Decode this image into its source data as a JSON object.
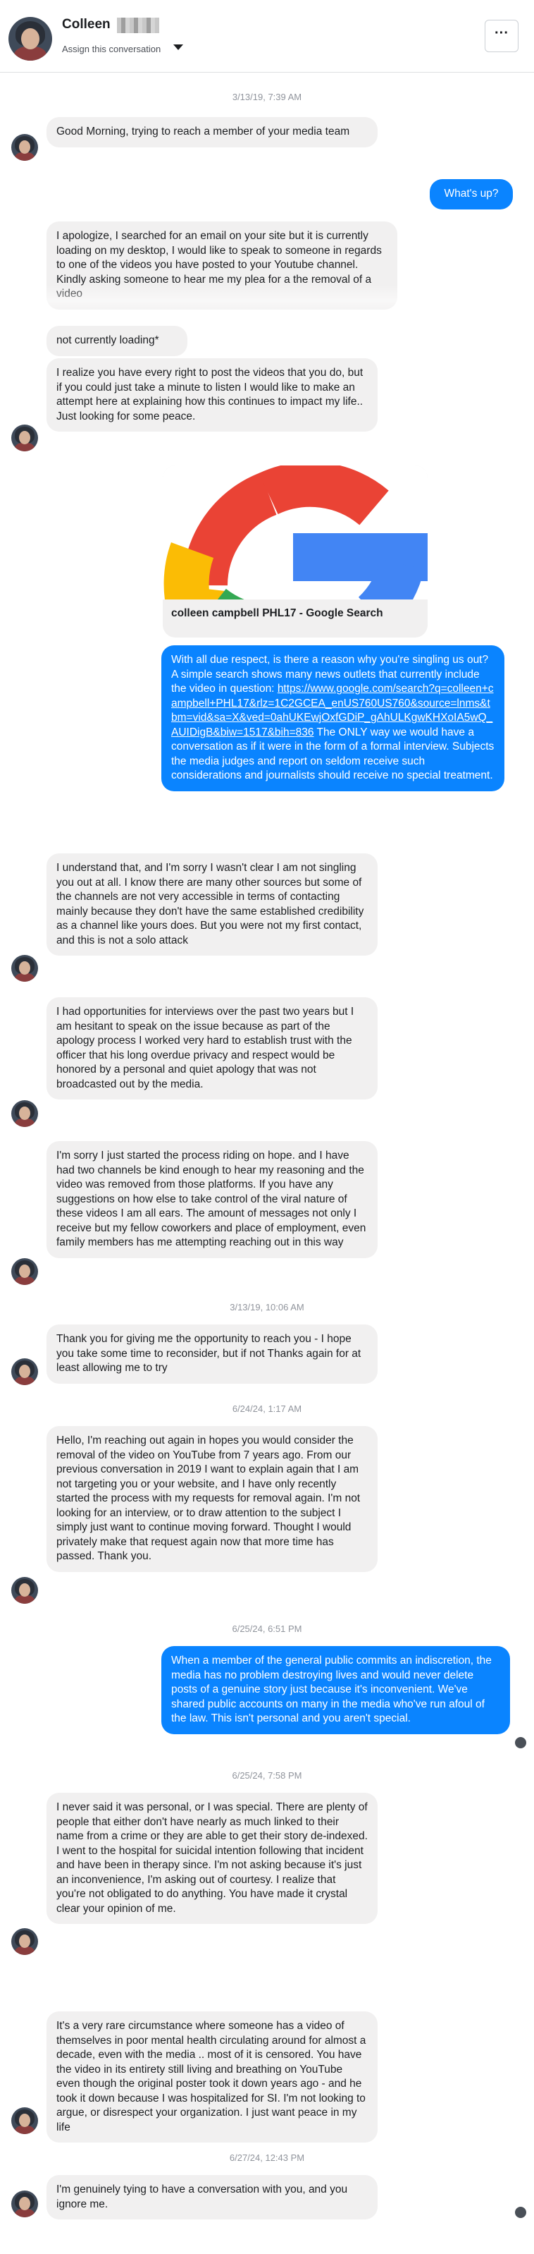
{
  "header": {
    "contact_name": "Colleen",
    "assign_label": "Assign this conversation",
    "more_label": "···"
  },
  "timestamps": [
    "3/13/19, 7:39 AM",
    "3/13/19, 10:06 AM",
    "6/24/24, 1:17 AM",
    "6/25/24, 6:51 PM",
    "6/25/24, 7:58 PM",
    "6/27/24, 12:43 PM"
  ],
  "messages": [
    {
      "from": "them",
      "text": "Good Morning, trying to reach a member of your media team"
    },
    {
      "from": "me",
      "text": "What's up?"
    },
    {
      "from": "them",
      "text": "I apologize, I searched for an email on your site but it is currently loading on my desktop, I would like to speak to someone in regards to one of the videos you have posted to your Youtube channel. Kindly asking someone to hear me my plea for a the removal of a video"
    },
    {
      "from": "them",
      "text": "not currently loading*"
    },
    {
      "from": "them",
      "text": "I realize you have every right to post the videos that you do, but if you could just take a minute to listen I would like to make an attempt here at explaining how this continues to impact my life.. Just looking for some peace."
    },
    {
      "from": "me",
      "text_before": "With all due respect, is there a reason why you're singling us out? A simple search shows many news outlets that currently include the video in question: ",
      "link": "https://www.google.com/search?q=colleen+campbell+PHL17&rlz=1C2GCEA_enUS760US760&source=lnms&tbm=vid&sa=X&ved=0ahUKEwjOxfGDiP_gAhULKgwKHXoIA5wQ_AUIDigB&biw=1517&bih=836",
      "text_after": " The ONLY way we would have a conversation as if it were in the form of a formal interview. Subjects the media judges and report on seldom receive such considerations and journalists should receive no special treatment."
    },
    {
      "from": "them",
      "text": "I understand that, and I'm sorry I wasn't clear I am not singling you out at all. I know there are many other sources but some of the channels are not very accessible in terms of contacting mainly because they don't have the same established credibility as a channel like yours does. But you were not my first contact, and this is not a solo attack"
    },
    {
      "from": "them",
      "text": "I had opportunities for interviews over the past two years but I am hesitant to speak on the issue because as part of the apology process I worked very hard to establish trust with the officer that his long overdue privacy and respect would be honored by a personal and quiet apology that was not broadcasted out by the media."
    },
    {
      "from": "them",
      "text": "I'm sorry I just started the process riding on hope. and I have had two channels be kind enough to hear my reasoning and the video was removed from those platforms. If you have any suggestions on how else to take control of the viral nature of these videos I am all ears. The amount of messages not only I receive but my fellow coworkers and place of employment, even family members has me attempting reaching out in this way"
    },
    {
      "from": "them",
      "text": "Thank you for giving me the opportunity to reach you - I hope you take some time to reconsider, but if not Thanks again for at least allowing me to try"
    },
    {
      "from": "them",
      "text": "Hello, I'm reaching out again in hopes you would consider the removal of the video on YouTube from 7 years ago. From our previous conversation in 2019 I want to explain again that I am not targeting you or your website, and I have only recently started the process with my requests for removal again. I'm not looking for an interview, or to draw attention to the subject I simply just want to continue moving forward. Thought I would privately make that request again now that more time has passed. Thank you."
    },
    {
      "from": "me",
      "text": "When a member of the general public commits an indiscretion, the media has no problem destroying lives and would never delete posts of a genuine story just because it's inconvenient. We've shared public accounts on many in the media who've run afoul of the law. This isn't personal and you aren't special."
    },
    {
      "from": "them",
      "text": "I never said it was personal, or I was special. There are plenty of people that either don't have nearly as much linked to their name from a crime or they are able to get their story de-indexed. I went to the hospital for suicidal intention following that incident and have been in therapy since. I'm not asking because it's just an inconvenience, I'm asking out of courtesy. I realize that you're not obligated to do anything. You have made it crystal clear your opinion of me."
    },
    {
      "from": "them",
      "text": "It's a very rare circumstance where someone has a video of themselves in poor mental health circulating around for almost a decade, even with the media .. most of it is censored. You have the video in its entirety still living and breathing on YouTube even though the original poster took it down years ago - and he took it down because I was hospitalized for SI. I'm not looking to argue, or disrespect your organization. I just want peace in my life"
    },
    {
      "from": "them",
      "text": "I'm genuinely tying to have a conversation with you, and you ignore me."
    }
  ],
  "link_preview": {
    "title": "colleen campbell PHL17 - Google Search",
    "image_icon": "google-g-logo"
  },
  "colors": {
    "outgoing_bubble": "#0a84ff",
    "incoming_bubble": "#f1f0f0",
    "timestamp": "#90949c"
  }
}
